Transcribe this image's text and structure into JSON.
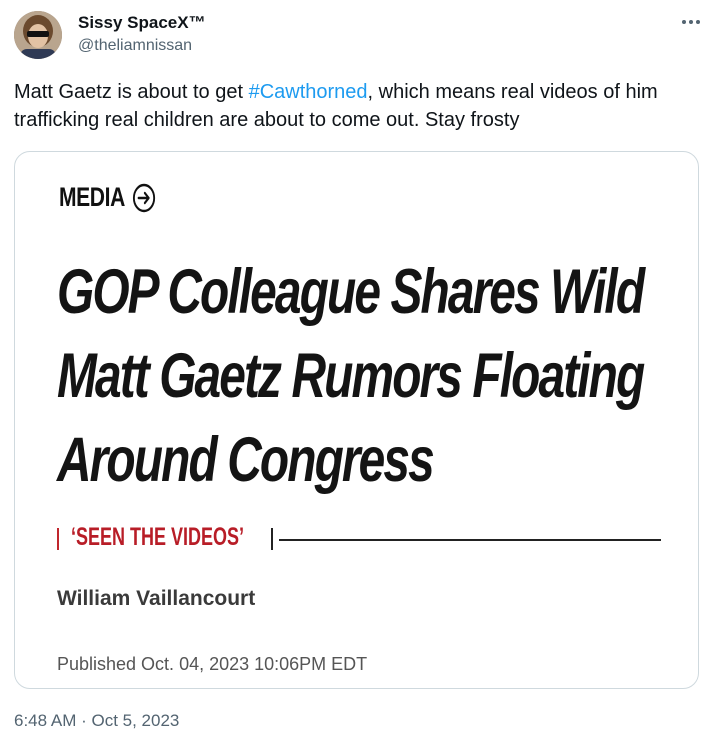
{
  "tweet": {
    "author_name": "Sissy SpaceX™",
    "handle": "@theliamnissan",
    "more_icon": "more-horizontal-icon",
    "text_part1": "Matt Gaetz is about to get ",
    "hashtag": "#Cawthorned",
    "text_part2": ", which means real videos of him trafficking real children are about to come out. Stay frosty",
    "timestamp": "6:48 AM · Oct 5, 2023",
    "hashtag_color": "#1d9bf0"
  },
  "card": {
    "section_label": "MEDIA",
    "section_icon": "arrow-circle-right-icon",
    "headline_lines": [
      "GOP Colleague Shares Wild",
      "Matt Gaetz Rumors Floating",
      "Around Congress"
    ],
    "kicker": "‘SEEN THE VIDEOS’",
    "author": "William Vaillancourt",
    "published": "Published Oct. 04, 2023 10:06PM EDT",
    "kicker_color": "#b81d27"
  }
}
